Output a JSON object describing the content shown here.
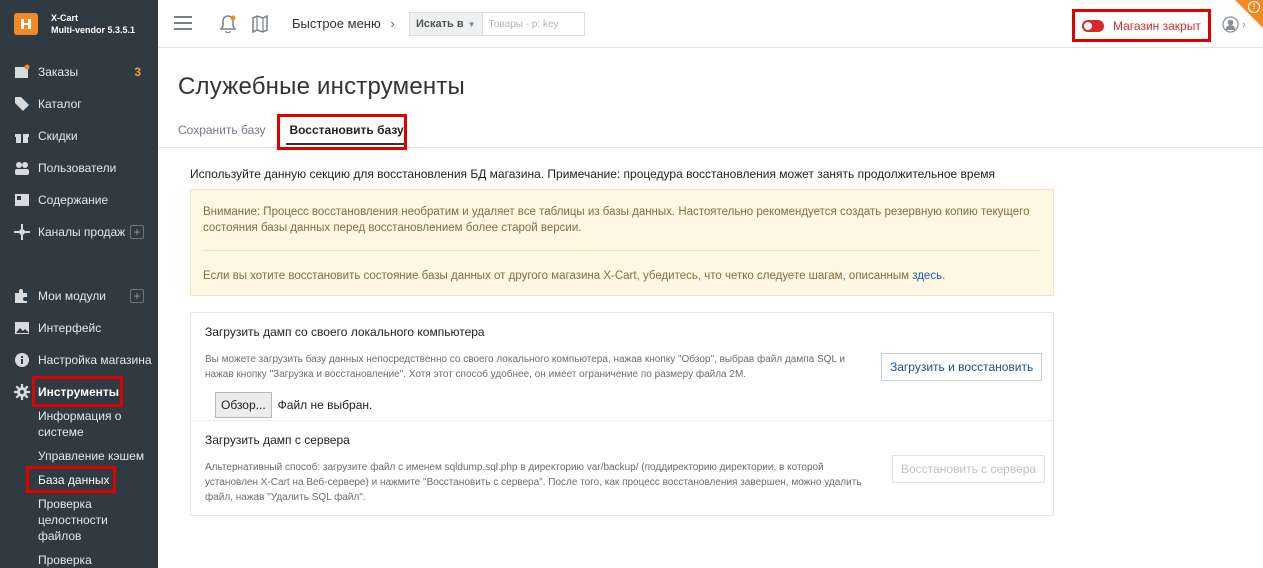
{
  "brand": {
    "name": "X-Cart",
    "version": "Multi-vendor 5.3.5.1"
  },
  "sidebar": {
    "items": [
      {
        "label": "Заказы",
        "icon": "orders-icon",
        "badge": "3"
      },
      {
        "label": "Каталог",
        "icon": "tag-icon"
      },
      {
        "label": "Скидки",
        "icon": "gift-icon"
      },
      {
        "label": "Пользователи",
        "icon": "users-icon"
      },
      {
        "label": "Содержание",
        "icon": "content-icon"
      },
      {
        "label": "Каналы продаж",
        "icon": "channels-icon",
        "plus": "+"
      }
    ],
    "items2": [
      {
        "label": "Мои модули",
        "icon": "puzzle-icon",
        "plus": "+"
      },
      {
        "label": "Интерфейс",
        "icon": "image-icon"
      },
      {
        "label": "Настройка магазина",
        "icon": "info-icon"
      },
      {
        "label": "Инструменты",
        "icon": "gear-icon"
      }
    ],
    "subitems": [
      "Информация о системе",
      "Управление кэшем",
      "База данных",
      "Проверка целостности файлов",
      "Проверка"
    ]
  },
  "topbar": {
    "quick_menu": "Быстрое меню",
    "search_scope": "Искать в",
    "search_placeholder": "Товары - p: key",
    "store_status": "Магазин закрыт"
  },
  "page": {
    "title": "Служебные инструменты",
    "tabs": [
      "Сохранить базу",
      "Восстановить базу"
    ],
    "intro": "Используйте данную секцию для восстановления БД магазина. Примечание: процедура восстановления может занять продолжительное время",
    "warning1": "Внимание: Процесс восстановления необратим и удаляет все таблицы из базы данных. Настоятельно рекомендуется создать резервную копию текущего состояния базы данных перед восстановлением более старой версии.",
    "warning2": "Если вы хотите восстановить состояние базы данных от другого магазина X-Cart, убедитесь, что четко следуете шагам, описанным",
    "warning2_link": "здесь",
    "warning2_end": ".",
    "local": {
      "title": "Загрузить дамп со своего локального компьютера",
      "desc": "Вы можете загрузить базу данных непосредственно со своего локального компьютера, нажав кнопку \"Обзор\", выбрав файл дампа SQL и нажав кнопку \"Загрузка и восстановление\". Хотя этот способ удобнее, он имеет ограничение по размеру файла 2M.",
      "button": "Загрузить и восстановить",
      "browse": "Обзор...",
      "no_file": "Файл не выбран."
    },
    "server": {
      "title": "Загрузить дамп с сервера",
      "desc": "Альтернативный способ: загрузите файл с именем sqldump.sql.php в директорию var/backup/ (поддиректорию директории, в которой установлен X-Cart на Веб-сервере) и нажмите \"Восстановить с сервера\". После того, как процесс восстановления завершен, можно удалить файл, нажав \"Удалить SQL файл\".",
      "button": "Восстановить с сервера"
    }
  },
  "colors": {
    "sidebar": "#2f3a42",
    "accent": "#f08a24",
    "highlight": "#e00000",
    "closed": "#d9272e"
  }
}
